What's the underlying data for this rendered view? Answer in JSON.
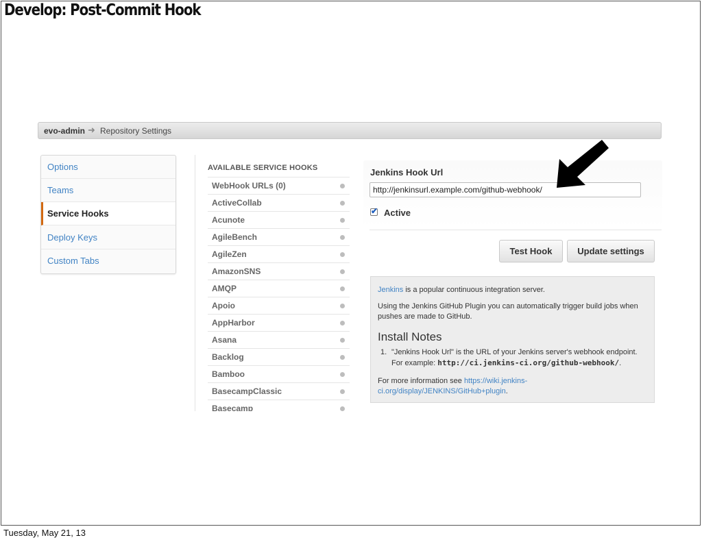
{
  "slide": {
    "title": "Develop: Post-Commit Hook",
    "footer_date": "Tuesday, May 21, 13"
  },
  "breadcrumb": {
    "owner": "evo-admin",
    "separator_icon": "arrow-right-icon",
    "page": "Repository Settings"
  },
  "sidebar": {
    "items": [
      {
        "label": "Options",
        "selected": false
      },
      {
        "label": "Teams",
        "selected": false
      },
      {
        "label": "Service Hooks",
        "selected": true
      },
      {
        "label": "Deploy Keys",
        "selected": false
      },
      {
        "label": "Custom Tabs",
        "selected": false
      }
    ]
  },
  "hooks_list": {
    "title": "AVAILABLE SERVICE HOOKS",
    "items": [
      "WebHook URLs (0)",
      "ActiveCollab",
      "Acunote",
      "AgileBench",
      "AgileZen",
      "AmazonSNS",
      "AMQP",
      "Apoio",
      "AppHarbor",
      "Asana",
      "Backlog",
      "Bamboo",
      "BasecampClassic",
      "Basecamp"
    ]
  },
  "hook_form": {
    "url_label": "Jenkins Hook Url",
    "url_value": "http://jenkinsurl.example.com/github-webhook/",
    "active_label": "Active",
    "active_checked": true,
    "test_button": "Test Hook",
    "update_button": "Update settings"
  },
  "info": {
    "intro_link": "Jenkins",
    "intro_text": " is a popular continuous integration server.",
    "plugin_text": "Using the Jenkins GitHub Plugin you can automatically trigger build jobs when pushes are made to GitHub.",
    "install_title": "Install Notes",
    "note_number": "1.",
    "note_line1": "\"Jenkins Hook Url\" is the URL of your Jenkins server's webhook endpoint.",
    "note_line2_prefix": "For example: ",
    "note_line2_code": "http://ci.jenkins-ci.org/github-webhook/",
    "note_line2_suffix": ".",
    "more_prefix": "For more information see ",
    "more_link": "https://wiki.jenkins-ci.org/display/JENKINS/GitHub+plugin",
    "more_suffix": "."
  },
  "colors": {
    "link": "#4183c4",
    "selected_accent": "#d26911"
  }
}
